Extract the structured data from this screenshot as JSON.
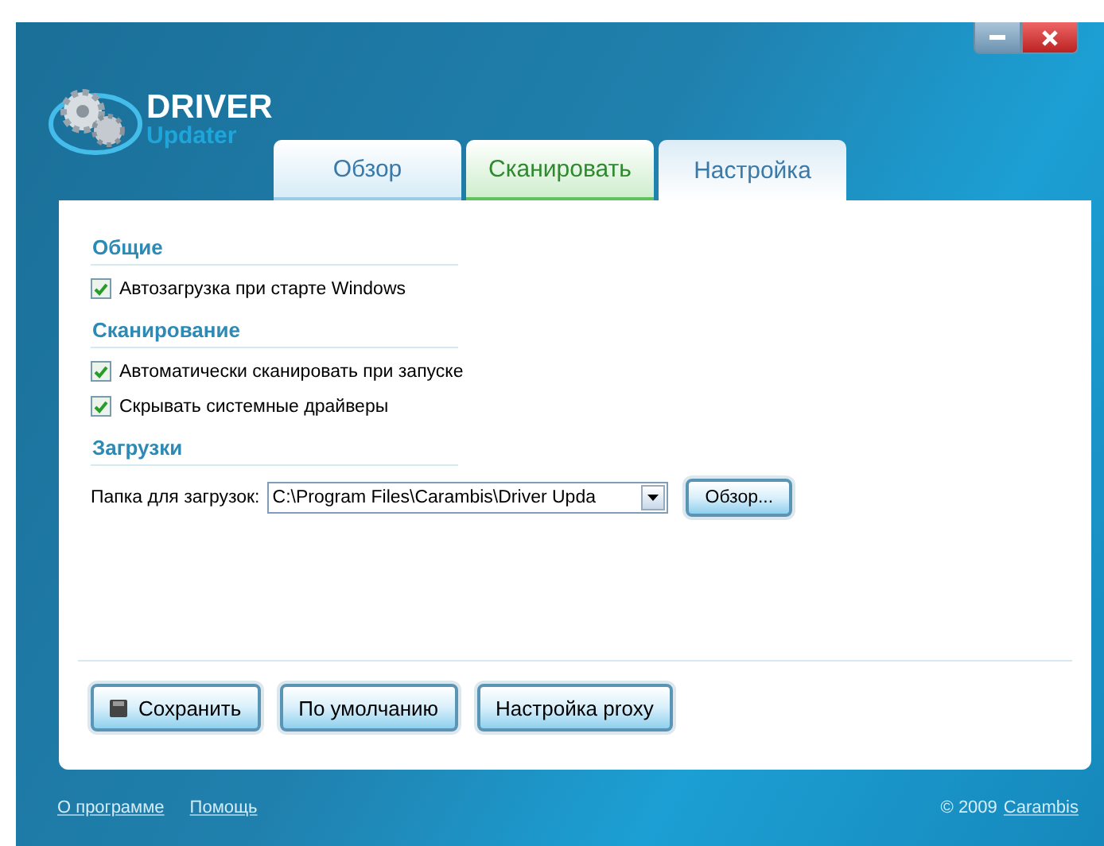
{
  "logo": {
    "title": "DRIVER",
    "subtitle": "Updater"
  },
  "tabs": [
    {
      "label": "Обзор",
      "selected": false,
      "kind": "plain"
    },
    {
      "label": "Сканировать",
      "selected": false,
      "kind": "scan"
    },
    {
      "label": "Настройка",
      "selected": true,
      "kind": "plain"
    }
  ],
  "sections": [
    {
      "title": "Общие",
      "options": [
        {
          "label": "Автозагрузка при старте Windows",
          "checked": true
        }
      ]
    },
    {
      "title": "Сканирование",
      "options": [
        {
          "label": "Автоматически сканировать при запуске",
          "checked": true
        },
        {
          "label": "Скрывать системные драйверы",
          "checked": true
        }
      ]
    },
    {
      "title": "Загрузки",
      "folder": {
        "label": "Папка для загрузок:",
        "value": "C:\\Program Files\\Carambis\\Driver Upda",
        "browse": "Обзор..."
      }
    }
  ],
  "buttons": [
    {
      "label": "Сохранить",
      "kind": "save"
    },
    {
      "label": "По умолчанию",
      "kind": "plain"
    },
    {
      "label": "Настройка proxy",
      "kind": "plain"
    }
  ],
  "footer": {
    "links": [
      "О программе",
      "Помощь"
    ],
    "copyright": "© 2009",
    "company": "Carambis"
  }
}
